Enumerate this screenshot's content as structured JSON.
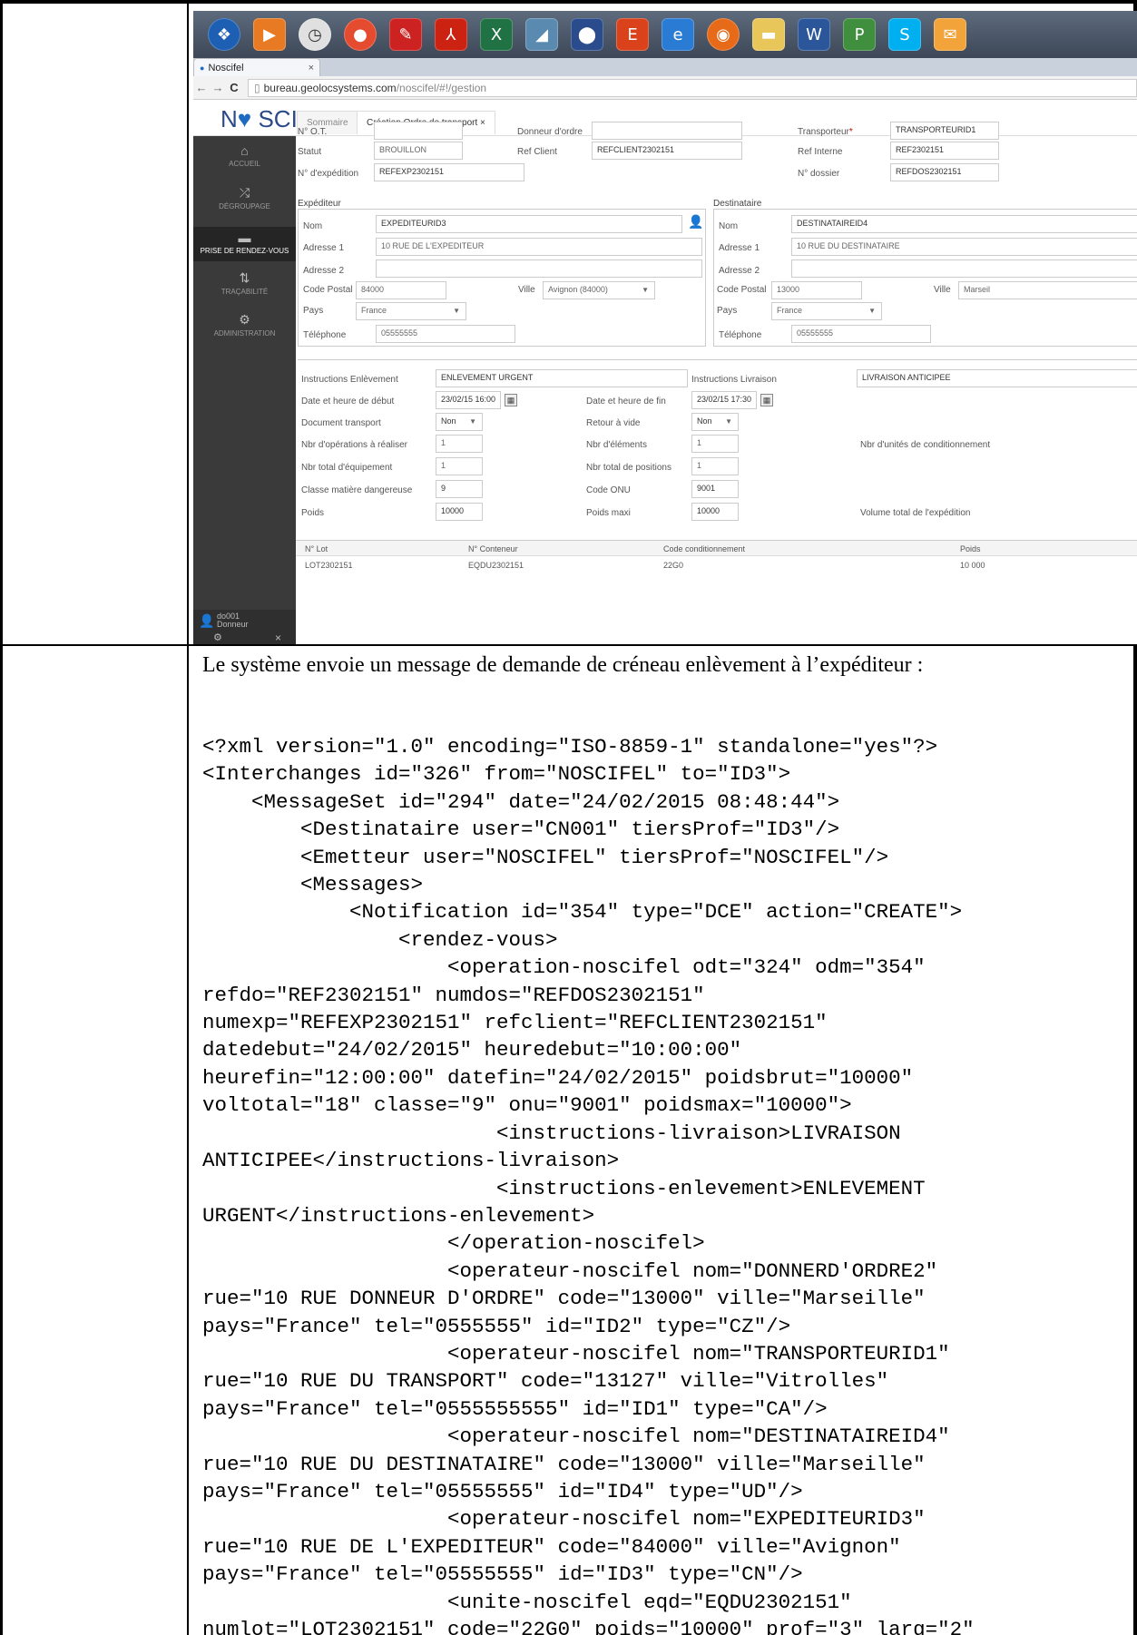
{
  "taskbar": {
    "icons": [
      "start-orb-icon",
      "media-player-icon",
      "clock-icon",
      "chrome-icon",
      "pin-icon",
      "acrobat-icon",
      "excel-icon",
      "generic-app-icon",
      "security-icon",
      "ec-app-icon",
      "ie-icon",
      "firefox-icon",
      "folder-icon",
      "word-icon",
      "project-icon",
      "skype-icon",
      "outlook-icon"
    ]
  },
  "browser": {
    "tab_title": "Noscifel",
    "url_host": "bureau.geolocsystems.com",
    "url_path": "/noscifel/#!/gestion"
  },
  "app": {
    "logo": {
      "part1": "N",
      "part2": "SCIFeL"
    },
    "tabs": [
      {
        "label": "Sommaire"
      },
      {
        "label": "Création Ordre de transport ×"
      }
    ],
    "sidebar": [
      {
        "label": "ACCUEIL"
      },
      {
        "label": "DÉGROUPAGE"
      },
      {
        "label": "PRISE DE RENDEZ-VOUS"
      },
      {
        "label": "TRAÇABILITÉ"
      },
      {
        "label": "ADMINISTRATION"
      }
    ],
    "user": {
      "id": "do001",
      "role": "Donneur d'ordre"
    }
  },
  "form": {
    "ot_label": "N° O.T.",
    "ot_value": "",
    "donneur_label": "Donneur d'ordre",
    "donneur_value": "",
    "transporteur_label": "Transporteur",
    "transporteur_value": "TRANSPORTEURID1",
    "statut_label": "Statut",
    "statut_value": "BROUILLON",
    "refclient_label": "Ref Client",
    "refclient_value": "REFCLIENT2302151",
    "refinterne_label": "Ref Interne",
    "refinterne_value": "REF2302151",
    "expedition_label": "N° d'expédition",
    "expedition_value": "REFEXP2302151",
    "dossier_label": "N° dossier",
    "dossier_value": "REFDOS2302151",
    "expediteur": {
      "title": "Expéditeur",
      "nom_label": "Nom",
      "nom": "EXPEDITEURID3",
      "adr1_label": "Adresse 1",
      "adr1": "10 RUE DE L'EXPEDITEUR",
      "adr2_label": "Adresse 2",
      "adr2": "",
      "cp_label": "Code Postal",
      "cp": "84000",
      "ville_label": "Ville",
      "ville": "Avignon (84000)",
      "pays_label": "Pays",
      "pays": "France",
      "tel_label": "Téléphone",
      "tel": "05555555"
    },
    "destinataire": {
      "title": "Destinataire",
      "nom_label": "Nom",
      "nom": "DESTINATAIREID4",
      "adr1_label": "Adresse 1",
      "adr1": "10 RUE DU DESTINATAIRE",
      "adr2_label": "Adresse 2",
      "adr2": "",
      "cp_label": "Code Postal",
      "cp": "13000",
      "ville_label": "Ville",
      "ville": "Marseil",
      "pays_label": "Pays",
      "pays": "France",
      "tel_label": "Téléphone",
      "tel": "05555555"
    },
    "details": {
      "instr_enl_label": "Instructions Enlèvement",
      "instr_enl": "ENLEVEMENT URGENT",
      "instr_liv_label": "Instructions Livraison",
      "instr_liv": "LIVRAISON ANTICIPEE",
      "debut_label": "Date et heure de début",
      "debut": "23/02/15 16:00",
      "fin_label": "Date et heure de fin",
      "fin": "23/02/15 17:30",
      "doc_label": "Document transport",
      "doc": "Non",
      "retour_label": "Retour à vide",
      "retour": "Non",
      "nbops_label": "Nbr d'opérations à réaliser",
      "nbops": "1",
      "nbelem_label": "Nbr d'éléments",
      "nbelem": "1",
      "nbunits_label": "Nbr d'unités de conditionnement",
      "nbequip_label": "Nbr total d'équipement",
      "nbequip": "1",
      "nbpos_label": "Nbr total de positions",
      "nbpos": "1",
      "classe_label": "Classe matière dangereuse",
      "classe": "9",
      "onu_label": "Code ONU",
      "onu": "9001",
      "poids_label": "Poids",
      "poids": "10000",
      "poidsmax_label": "Poids maxi",
      "poidsmax": "10000",
      "volume_label": "Volume total de l'expédition"
    },
    "grid": {
      "headers": [
        "N° Lot",
        "N° Conteneur",
        "Code conditionnement",
        "Poids"
      ],
      "row": [
        "LOT2302151",
        "EQDU2302151",
        "22G0",
        "10 000"
      ]
    }
  },
  "doc": {
    "intro": "Le système envoie un message de demande de créneau enlèvement à l’expéditeur :",
    "xml_lines": [
      "<?xml version=\"1.0\" encoding=\"ISO-8859-1\" standalone=\"yes\"?>",
      "<Interchanges id=\"326\" from=\"NOSCIFEL\" to=\"ID3\">",
      "    <MessageSet id=\"294\" date=\"24/02/2015 08:48:44\">",
      "        <Destinataire user=\"CN001\" tiersProf=\"ID3\"/>",
      "        <Emetteur user=\"NOSCIFEL\" tiersProf=\"NOSCIFEL\"/>",
      "        <Messages>",
      "            <Notification id=\"354\" type=\"DCE\" action=\"CREATE\">",
      "                <rendez-vous>",
      "                    <operation-noscifel odt=\"324\" odm=\"354\"",
      "refdo=\"REF2302151\" numdos=\"REFDOS2302151\"",
      "numexp=\"REFEXP2302151\" refclient=\"REFCLIENT2302151\"",
      "datedebut=\"24/02/2015\" heuredebut=\"10:00:00\"",
      "heurefin=\"12:00:00\" datefin=\"24/02/2015\" poidsbrut=\"10000\"",
      "voltotal=\"18\" classe=\"9\" onu=\"9001\" poidsmax=\"10000\">",
      "                        <instructions-livraison>LIVRAISON",
      "ANTICIPEE</instructions-livraison>",
      "                        <instructions-enlevement>ENLEVEMENT",
      "URGENT</instructions-enlevement>",
      "                    </operation-noscifel>",
      "                    <operateur-noscifel nom=\"DONNERD'ORDRE2\"",
      "rue=\"10 RUE DONNEUR D'ORDRE\" code=\"13000\" ville=\"Marseille\"",
      "pays=\"France\" tel=\"0555555\" id=\"ID2\" type=\"CZ\"/>",
      "                    <operateur-noscifel nom=\"TRANSPORTEURID1\"",
      "rue=\"10 RUE DU TRANSPORT\" code=\"13127\" ville=\"Vitrolles\"",
      "pays=\"France\" tel=\"0555555555\" id=\"ID1\" type=\"CA\"/>",
      "                    <operateur-noscifel nom=\"DESTINATAIREID4\"",
      "rue=\"10 RUE DU DESTINATAIRE\" code=\"13000\" ville=\"Marseille\"",
      "pays=\"France\" tel=\"05555555\" id=\"ID4\" type=\"UD\"/>",
      "                    <operateur-noscifel nom=\"EXPEDITEURID3\"",
      "rue=\"10 RUE DE L'EXPEDITEUR\" code=\"84000\" ville=\"Avignon\"",
      "pays=\"France\" tel=\"05555555\" id=\"ID3\" type=\"CN\"/>",
      "                    <unite-noscifel eqd=\"EQDU2302151\"",
      "numlot=\"LOT2302151\" code=\"22G0\" poids=\"10000\" prof=\"3\" larg=\"2\""
    ]
  }
}
